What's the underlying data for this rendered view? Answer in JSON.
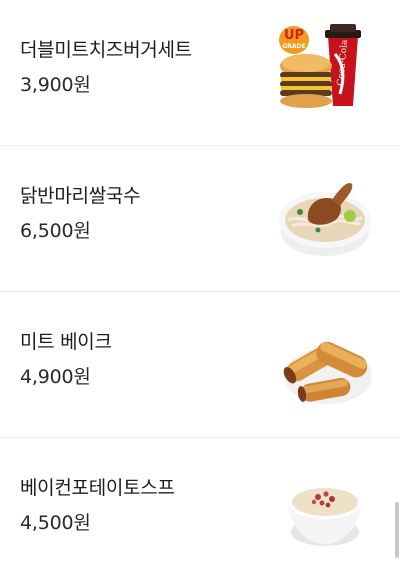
{
  "menu": {
    "items": [
      {
        "name": "더블미트치즈버거세트",
        "price": "3,900원",
        "image_icon": "burger-set-image",
        "badge_top": "UP",
        "badge_bottom": "GRADE",
        "cup_text": "Coca-Cola"
      },
      {
        "name": "닭반마리쌀국수",
        "price": "6,500원",
        "image_icon": "chicken-rice-noodle-image"
      },
      {
        "name": "미트 베이크",
        "price": "4,900원",
        "image_icon": "meat-bake-image"
      },
      {
        "name": "베이컨포테이토스프",
        "price": "4,500원",
        "image_icon": "bacon-potato-soup-image"
      }
    ]
  }
}
